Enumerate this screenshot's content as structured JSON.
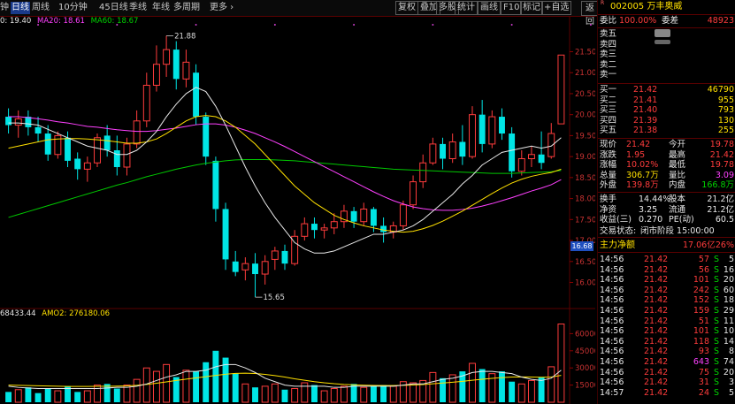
{
  "toolbar": {
    "periods": [
      {
        "label": "钟",
        "active": false
      },
      {
        "label": "日线",
        "active": true
      },
      {
        "label": "周线",
        "active": false
      },
      {
        "label": "10分钟",
        "active": false
      },
      {
        "label": "45日线",
        "active": false
      },
      {
        "label": "季线",
        "active": false
      },
      {
        "label": "年线",
        "active": false
      },
      {
        "label": "多周期",
        "active": false
      },
      {
        "label": "更多 ›",
        "active": false
      }
    ],
    "tools": [
      {
        "label": "复权",
        "selected": false
      },
      {
        "label": "叠加",
        "selected": false
      },
      {
        "label": "多股",
        "selected": false
      },
      {
        "label": "统计",
        "selected": false
      },
      {
        "label": "画线",
        "selected": false
      },
      {
        "label": "F10",
        "selected": false
      },
      {
        "label": "标记",
        "selected": false
      },
      {
        "label": "+自选",
        "selected": false
      },
      {
        "label": "返回",
        "selected": false
      }
    ],
    "close_glyph": "✕"
  },
  "ma_legend": {
    "ma10": "0: 19.40",
    "ma20": "MA20: 18.61",
    "ma60": "MA60: 18.67"
  },
  "vol_legend": {
    "vol": "68433.44",
    "amo2": "AMO2: 276180.06"
  },
  "chart_price_tag": "16.68",
  "colors": {
    "up": "#ff3c3c",
    "down": "#00e5e5",
    "ma_white": "#e8e8e8",
    "ma_yellow": "#ffe000",
    "ma_magenta": "#ff40ff",
    "ma_green": "#00c800",
    "grid": "#5a0000"
  },
  "chart_data": [
    {
      "type": "candlestick",
      "y_ticks": [
        "21.50",
        "21.00",
        "20.50",
        "20.00",
        "19.50",
        "19.00",
        "18.50",
        "18.00",
        "17.50",
        "17.00",
        "16.50",
        "16.00"
      ],
      "ylim": [
        15.4,
        22.1
      ],
      "annotations": [
        {
          "label": "21.88",
          "value": 21.88
        },
        {
          "label": "15.65",
          "value": 15.65
        }
      ],
      "candles": [
        {
          "o": 19.95,
          "h": 20.15,
          "l": 19.55,
          "c": 19.75
        },
        {
          "o": 19.75,
          "h": 20.1,
          "l": 19.45,
          "c": 19.9
        },
        {
          "o": 19.95,
          "h": 20.1,
          "l": 19.5,
          "c": 19.7
        },
        {
          "o": 19.7,
          "h": 19.95,
          "l": 19.35,
          "c": 19.55
        },
        {
          "o": 19.55,
          "h": 19.75,
          "l": 18.9,
          "c": 19.05
        },
        {
          "o": 19.05,
          "h": 19.6,
          "l": 18.95,
          "c": 19.5
        },
        {
          "o": 19.45,
          "h": 19.6,
          "l": 18.75,
          "c": 18.9
        },
        {
          "o": 18.95,
          "h": 19.1,
          "l": 18.45,
          "c": 18.7
        },
        {
          "o": 18.7,
          "h": 19.0,
          "l": 18.4,
          "c": 18.85
        },
        {
          "o": 18.85,
          "h": 19.55,
          "l": 18.75,
          "c": 19.45
        },
        {
          "o": 19.5,
          "h": 19.75,
          "l": 19.0,
          "c": 19.15
        },
        {
          "o": 19.15,
          "h": 19.5,
          "l": 18.55,
          "c": 18.75
        },
        {
          "o": 18.75,
          "h": 19.45,
          "l": 18.55,
          "c": 19.3
        },
        {
          "o": 19.3,
          "h": 20.1,
          "l": 19.2,
          "c": 19.85
        },
        {
          "o": 19.85,
          "h": 21.0,
          "l": 19.7,
          "c": 20.7
        },
        {
          "o": 20.7,
          "h": 21.65,
          "l": 20.55,
          "c": 21.2
        },
        {
          "o": 21.2,
          "h": 21.88,
          "l": 20.9,
          "c": 21.55
        },
        {
          "o": 21.55,
          "h": 21.75,
          "l": 20.6,
          "c": 20.85
        },
        {
          "o": 20.85,
          "h": 21.55,
          "l": 20.65,
          "c": 21.25
        },
        {
          "o": 21.0,
          "h": 21.2,
          "l": 19.75,
          "c": 19.95
        },
        {
          "o": 19.95,
          "h": 20.05,
          "l": 18.8,
          "c": 19.0
        },
        {
          "o": 18.9,
          "h": 19.0,
          "l": 17.45,
          "c": 17.75
        },
        {
          "o": 17.75,
          "h": 17.9,
          "l": 16.3,
          "c": 16.55
        },
        {
          "o": 16.5,
          "h": 16.75,
          "l": 16.15,
          "c": 16.25
        },
        {
          "o": 16.3,
          "h": 16.6,
          "l": 16.05,
          "c": 16.45
        },
        {
          "o": 16.45,
          "h": 16.7,
          "l": 15.65,
          "c": 16.2
        },
        {
          "o": 16.2,
          "h": 16.65,
          "l": 15.95,
          "c": 16.5
        },
        {
          "o": 16.55,
          "h": 16.85,
          "l": 16.3,
          "c": 16.75
        },
        {
          "o": 16.75,
          "h": 16.9,
          "l": 16.3,
          "c": 16.45
        },
        {
          "o": 16.45,
          "h": 17.25,
          "l": 16.4,
          "c": 17.1
        },
        {
          "o": 17.1,
          "h": 17.55,
          "l": 17.0,
          "c": 17.4
        },
        {
          "o": 17.4,
          "h": 17.55,
          "l": 17.05,
          "c": 17.25
        },
        {
          "o": 17.25,
          "h": 17.4,
          "l": 17.05,
          "c": 17.3
        },
        {
          "o": 17.3,
          "h": 17.65,
          "l": 17.15,
          "c": 17.45
        },
        {
          "o": 17.45,
          "h": 17.85,
          "l": 17.3,
          "c": 17.7
        },
        {
          "o": 17.7,
          "h": 17.8,
          "l": 17.3,
          "c": 17.45
        },
        {
          "o": 17.45,
          "h": 17.9,
          "l": 17.35,
          "c": 17.75
        },
        {
          "o": 17.75,
          "h": 17.8,
          "l": 17.2,
          "c": 17.35
        },
        {
          "o": 17.35,
          "h": 17.55,
          "l": 16.95,
          "c": 17.2
        },
        {
          "o": 17.2,
          "h": 17.45,
          "l": 17.05,
          "c": 17.35
        },
        {
          "o": 17.35,
          "h": 17.95,
          "l": 17.25,
          "c": 17.85
        },
        {
          "o": 17.85,
          "h": 18.55,
          "l": 17.75,
          "c": 18.4
        },
        {
          "o": 18.4,
          "h": 19.05,
          "l": 18.25,
          "c": 18.85
        },
        {
          "o": 18.85,
          "h": 19.45,
          "l": 18.8,
          "c": 19.3
        },
        {
          "o": 19.3,
          "h": 19.45,
          "l": 18.7,
          "c": 18.95
        },
        {
          "o": 18.95,
          "h": 19.55,
          "l": 18.85,
          "c": 19.35
        },
        {
          "o": 19.35,
          "h": 19.75,
          "l": 18.8,
          "c": 19.0
        },
        {
          "o": 19.0,
          "h": 20.2,
          "l": 18.95,
          "c": 20.0
        },
        {
          "o": 20.0,
          "h": 20.35,
          "l": 19.1,
          "c": 19.3
        },
        {
          "o": 19.3,
          "h": 20.1,
          "l": 19.2,
          "c": 19.95
        },
        {
          "o": 19.95,
          "h": 20.15,
          "l": 19.4,
          "c": 19.55
        },
        {
          "o": 19.55,
          "h": 19.7,
          "l": 18.5,
          "c": 18.65
        },
        {
          "o": 18.65,
          "h": 19.15,
          "l": 18.55,
          "c": 18.95
        },
        {
          "o": 18.95,
          "h": 19.25,
          "l": 18.75,
          "c": 19.05
        },
        {
          "o": 19.05,
          "h": 19.6,
          "l": 18.7,
          "c": 18.85
        },
        {
          "o": 19.0,
          "h": 19.8,
          "l": 18.95,
          "c": 19.55
        },
        {
          "o": 19.78,
          "h": 21.42,
          "l": 19.78,
          "c": 21.42
        }
      ],
      "ma_white": [
        19.8,
        19.8,
        19.78,
        19.75,
        19.65,
        19.55,
        19.45,
        19.35,
        19.25,
        19.2,
        19.15,
        19.05,
        19.05,
        19.15,
        19.35,
        19.6,
        19.95,
        20.25,
        20.5,
        20.65,
        20.55,
        20.2,
        19.75,
        19.25,
        18.75,
        18.3,
        17.9,
        17.55,
        17.25,
        16.95,
        16.8,
        16.7,
        16.7,
        16.75,
        16.85,
        16.95,
        17.05,
        17.15,
        17.15,
        17.2,
        17.25,
        17.35,
        17.5,
        17.7,
        17.9,
        18.1,
        18.35,
        18.55,
        18.8,
        18.95,
        19.1,
        19.15,
        19.2,
        19.25,
        19.2,
        19.25,
        19.45
      ],
      "ma_yellow": [
        19.2,
        19.25,
        19.3,
        19.35,
        19.4,
        19.42,
        19.43,
        19.43,
        19.42,
        19.4,
        19.38,
        19.35,
        19.32,
        19.32,
        19.35,
        19.42,
        19.55,
        19.7,
        19.85,
        19.95,
        19.98,
        19.95,
        19.85,
        19.7,
        19.5,
        19.3,
        19.05,
        18.8,
        18.55,
        18.3,
        18.1,
        17.9,
        17.75,
        17.6,
        17.5,
        17.42,
        17.35,
        17.3,
        17.25,
        17.22,
        17.2,
        17.22,
        17.28,
        17.36,
        17.46,
        17.58,
        17.7,
        17.84,
        17.98,
        18.12,
        18.25,
        18.37,
        18.46,
        18.53,
        18.58,
        18.62,
        18.7
      ],
      "ma_magenta": [
        19.95,
        19.95,
        19.93,
        19.9,
        19.87,
        19.83,
        19.8,
        19.76,
        19.72,
        19.7,
        19.67,
        19.64,
        19.62,
        19.6,
        19.6,
        19.62,
        19.65,
        19.68,
        19.72,
        19.76,
        19.78,
        19.78,
        19.75,
        19.7,
        19.63,
        19.55,
        19.45,
        19.35,
        19.24,
        19.12,
        19.0,
        18.88,
        18.76,
        18.64,
        18.52,
        18.4,
        18.28,
        18.16,
        18.05,
        17.95,
        17.87,
        17.8,
        17.76,
        17.73,
        17.72,
        17.72,
        17.74,
        17.77,
        17.82,
        17.88,
        17.95,
        18.02,
        18.1,
        18.18,
        18.25,
        18.33,
        18.45
      ],
      "ma_green": [
        17.55,
        17.62,
        17.69,
        17.76,
        17.83,
        17.9,
        17.97,
        18.04,
        18.11,
        18.18,
        18.25,
        18.32,
        18.38,
        18.45,
        18.52,
        18.58,
        18.64,
        18.7,
        18.75,
        18.8,
        18.84,
        18.87,
        18.9,
        18.92,
        18.93,
        18.93,
        18.93,
        18.92,
        18.91,
        18.9,
        18.88,
        18.86,
        18.84,
        18.82,
        18.8,
        18.78,
        18.76,
        18.74,
        18.72,
        18.7,
        18.69,
        18.68,
        18.67,
        18.66,
        18.65,
        18.64,
        18.63,
        18.62,
        18.61,
        18.6,
        18.6,
        18.6,
        18.61,
        18.62,
        18.63,
        18.64,
        18.67
      ]
    },
    {
      "type": "volume-bar",
      "y_ticks": [
        "60000",
        "45000",
        "30000",
        "15000"
      ],
      "ylim": [
        0,
        75000
      ],
      "volumes": [
        9000,
        11000,
        13000,
        8000,
        12000,
        10000,
        14000,
        9000,
        10000,
        15000,
        16000,
        12000,
        15000,
        20000,
        30000,
        27000,
        33000,
        22000,
        28000,
        27000,
        35000,
        45000,
        39000,
        25000,
        16000,
        13000,
        14000,
        16000,
        11000,
        12000,
        17000,
        15000,
        10000,
        12000,
        14000,
        16000,
        13000,
        14000,
        15000,
        14000,
        18000,
        17000,
        19000,
        26000,
        21000,
        24000,
        27000,
        34000,
        29000,
        25000,
        27000,
        18000,
        16000,
        19000,
        22000,
        31000,
        68433
      ],
      "ma_white": [
        14000,
        13000,
        12500,
        12000,
        12000,
        12000,
        12000,
        12000,
        12000,
        12000,
        12500,
        13000,
        13000,
        14000,
        16000,
        19000,
        22000,
        24000,
        27000,
        27000,
        28000,
        31000,
        33000,
        33000,
        30000,
        26000,
        21000,
        18000,
        15000,
        14000,
        14000,
        14000,
        14000,
        13000,
        13000,
        14000,
        14000,
        14000,
        14000,
        14000,
        15000,
        16000,
        16000,
        18000,
        20000,
        21000,
        23000,
        26000,
        27000,
        27000,
        26000,
        25000,
        22000,
        20000,
        19000,
        21000,
        28000
      ],
      "ma_yellow": [
        15000,
        14800,
        14600,
        14400,
        14200,
        14000,
        13800,
        13800,
        13800,
        13900,
        14000,
        14100,
        14300,
        14800,
        15600,
        16600,
        17800,
        19000,
        20200,
        21300,
        22300,
        23500,
        24500,
        25200,
        25400,
        25100,
        24400,
        23300,
        22000,
        20500,
        19200,
        18000,
        17000,
        16200,
        15600,
        15200,
        14900,
        14700,
        14600,
        14600,
        14800,
        15100,
        15500,
        16100,
        16800,
        17500,
        18300,
        19200,
        20100,
        20900,
        21600,
        22000,
        22100,
        22000,
        21800,
        22000,
        23500
      ],
      "ma_yellow_label": ""
    }
  ],
  "quote": {
    "title": "002005 万丰奥威",
    "code_badge": "R\nSH",
    "weibi": {
      "label": "委比",
      "value": "100.00%",
      "label2": "委差",
      "value2": "48923"
    },
    "sell": [
      {
        "label": "卖五",
        "price": "",
        "vol": ""
      },
      {
        "label": "卖四",
        "price": "",
        "vol": ""
      },
      {
        "label": "卖三",
        "price": "",
        "vol": ""
      },
      {
        "label": "卖二",
        "price": "",
        "vol": ""
      },
      {
        "label": "卖一",
        "price": "",
        "vol": ""
      }
    ],
    "buy": [
      {
        "label": "买一",
        "price": "21.42",
        "vol": "46790"
      },
      {
        "label": "买二",
        "price": "21.41",
        "vol": "955"
      },
      {
        "label": "买三",
        "price": "21.40",
        "vol": "793"
      },
      {
        "label": "买四",
        "price": "21.39",
        "vol": "130"
      },
      {
        "label": "买五",
        "price": "21.38",
        "vol": "255"
      }
    ],
    "stats": [
      {
        "l1": "现价",
        "v1": "21.42",
        "c1": "red",
        "l2": "今开",
        "v2": "19.78",
        "c2": "red"
      },
      {
        "l1": "涨跌",
        "v1": "1.95",
        "c1": "red",
        "l2": "最高",
        "v2": "21.42",
        "c2": "red"
      },
      {
        "l1": "涨幅",
        "v1": "10.02%",
        "c1": "red",
        "l2": "最低",
        "v2": "19.78",
        "c2": "red"
      },
      {
        "l1": "总量",
        "v1": "306.7万",
        "c1": "yel",
        "l2": "量比",
        "v2": "3.09",
        "c2": "mag"
      },
      {
        "l1": "外盘",
        "v1": "139.8万",
        "c1": "red",
        "l2": "内盘",
        "v2": "166.8万",
        "c2": "green"
      }
    ],
    "stats2": [
      {
        "l1": "换手",
        "v1": "14.44%",
        "c1": "white",
        "l2": "股本",
        "v2": "21.2亿",
        "c2": "white"
      },
      {
        "l1": "净资",
        "v1": "3.25",
        "c1": "white",
        "l2": "流通",
        "v2": "21.2亿",
        "c2": "white"
      },
      {
        "l1": "收益(三)",
        "v1": "0.270",
        "c1": "white",
        "l2": "PE(动)",
        "v2": "60.5",
        "c2": "white"
      }
    ],
    "status": {
      "label": "交易状态:",
      "value": "闭市阶段 15:00:00"
    },
    "main_flow": {
      "label": "主力净额",
      "value": "17.06亿",
      "pct": "26%"
    },
    "ticks": [
      {
        "t": "14:56",
        "p": "21.42",
        "v": "57",
        "d": "S",
        "n": "5"
      },
      {
        "t": "14:56",
        "p": "21.42",
        "v": "56",
        "d": "S",
        "n": "16"
      },
      {
        "t": "14:56",
        "p": "21.42",
        "v": "101",
        "d": "S",
        "n": "20"
      },
      {
        "t": "14:56",
        "p": "21.42",
        "v": "242",
        "d": "S",
        "n": "60"
      },
      {
        "t": "14:56",
        "p": "21.42",
        "v": "152",
        "d": "S",
        "n": "18"
      },
      {
        "t": "14:56",
        "p": "21.42",
        "v": "159",
        "d": "S",
        "n": "29"
      },
      {
        "t": "14:56",
        "p": "21.42",
        "v": "51",
        "d": "S",
        "n": "11"
      },
      {
        "t": "14:56",
        "p": "21.42",
        "v": "101",
        "d": "S",
        "n": "10"
      },
      {
        "t": "14:56",
        "p": "21.42",
        "v": "118",
        "d": "S",
        "n": "14"
      },
      {
        "t": "14:56",
        "p": "21.42",
        "v": "93",
        "d": "S",
        "n": "8"
      },
      {
        "t": "14:56",
        "p": "21.42",
        "v": "643",
        "d": "S",
        "n": "74"
      },
      {
        "t": "14:56",
        "p": "21.42",
        "v": "75",
        "d": "S",
        "n": "20"
      },
      {
        "t": "14:56",
        "p": "21.42",
        "v": "31",
        "d": "S",
        "n": "3"
      },
      {
        "t": "14:57",
        "p": "21.42",
        "v": "24",
        "d": "S",
        "n": "5"
      }
    ]
  }
}
